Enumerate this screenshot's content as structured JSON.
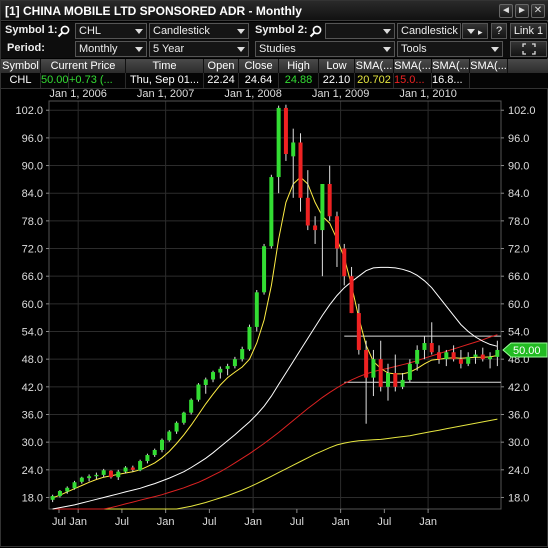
{
  "window": {
    "title": "[1] CHINA MOBILE LTD SPONSORED ADR - Monthly",
    "btn_left": "◄",
    "btn_right": "►",
    "btn_close": "✕"
  },
  "toolbar": {
    "symbol1_label": "Symbol 1:",
    "symbol1_value": "CHL",
    "style1_value": "Candlestick",
    "symbol2_label": "Symbol 2:",
    "symbol2_value": "",
    "style2_value": "Candlestick",
    "help_label": "?",
    "link_label": "Link 1",
    "period_label": "Period:",
    "period_value": "Monthly",
    "range_value": "5 Year",
    "studies_value": "Studies",
    "tools_value": "Tools"
  },
  "quote": {
    "headers": [
      "Symbol",
      "Current Price",
      "Time",
      "Open",
      "Close",
      "High",
      "Low",
      "SMA(...",
      "SMA(...",
      "SMA(...",
      "SMA(..."
    ],
    "values": [
      "CHL",
      "50.00",
      "+0.73 (...",
      "Thu, Sep 01...",
      "22.24",
      "24.64",
      "24.88",
      "22.10",
      "20.702",
      "15.0...",
      "16.8..."
    ],
    "up_color": "#33dd33",
    "down_color": "#ee2222"
  },
  "chart_data": {
    "type": "candlestick",
    "x_labels_top": [
      "Jan 1, 2006",
      "Jan 1, 2007",
      "Jan 1, 2008",
      "Jan 1, 2009",
      "Jan 1, 2010"
    ],
    "x_labels_bottom": [
      "Jul",
      "Jan",
      "Jul",
      "Jan",
      "Jul",
      "Jan",
      "Jul",
      "Jan",
      "Jul",
      "Jan"
    ],
    "y_ticks": [
      "102.0",
      "96.0",
      "90.0",
      "84.0",
      "78.0",
      "72.0",
      "66.0",
      "60.0",
      "54.0",
      "48.0",
      "42.0",
      "36.0",
      "30.0",
      "24.0",
      "18.0"
    ],
    "ylim": [
      15.5,
      104
    ],
    "current_price_label": "50.00",
    "candles": [
      [
        17.5,
        18.6,
        17.0,
        18.3
      ],
      [
        18.3,
        19.6,
        18.0,
        19.4
      ],
      [
        19.3,
        20.4,
        18.8,
        20.1
      ],
      [
        20.0,
        21.6,
        19.7,
        21.3
      ],
      [
        21.4,
        22.5,
        21.0,
        22.3
      ],
      [
        22.2,
        23.0,
        21.5,
        22.6
      ],
      [
        22.6,
        23.4,
        22.0,
        22.9
      ],
      [
        22.9,
        24.2,
        22.4,
        23.9
      ],
      [
        23.8,
        23.9,
        22.1,
        22.4
      ],
      [
        22.4,
        24.0,
        21.8,
        23.6
      ],
      [
        23.6,
        24.8,
        23.2,
        24.5
      ],
      [
        24.5,
        24.9,
        23.6,
        24.0
      ],
      [
        23.9,
        26.2,
        23.7,
        25.9
      ],
      [
        25.9,
        27.5,
        25.4,
        27.2
      ],
      [
        27.2,
        28.6,
        26.8,
        28.3
      ],
      [
        28.3,
        30.8,
        27.8,
        30.5
      ],
      [
        30.4,
        32.6,
        30.1,
        32.3
      ],
      [
        32.3,
        34.5,
        31.8,
        34.2
      ],
      [
        34.2,
        36.6,
        33.8,
        36.4
      ],
      [
        36.4,
        39.5,
        36.0,
        39.2
      ],
      [
        39.2,
        42.8,
        38.8,
        42.5
      ],
      [
        42.4,
        44.0,
        40.5,
        43.6
      ],
      [
        43.6,
        45.5,
        43.0,
        45.2
      ],
      [
        45.1,
        46.4,
        43.8,
        45.9
      ],
      [
        45.9,
        47.0,
        44.5,
        46.5
      ],
      [
        46.5,
        48.5,
        46.0,
        48.0
      ],
      [
        48.0,
        50.7,
        47.5,
        50.2
      ],
      [
        50.1,
        55.5,
        49.8,
        55.0
      ],
      [
        55.0,
        63.0,
        54.0,
        62.5
      ],
      [
        62.5,
        73.0,
        62.0,
        72.5
      ],
      [
        72.5,
        88.0,
        72.0,
        87.5
      ],
      [
        87.5,
        103.0,
        84.0,
        102.5
      ],
      [
        102.5,
        103.2,
        91.0,
        92.5
      ],
      [
        92.0,
        98.0,
        83.0,
        95.0
      ],
      [
        95.0,
        97.0,
        80.0,
        83.0
      ],
      [
        83.0,
        89.0,
        76.0,
        77.0
      ],
      [
        77.0,
        79.0,
        73.0,
        76.0
      ],
      [
        76.0,
        82.0,
        66.0,
        86.0
      ],
      [
        86.0,
        90.0,
        78.0,
        79.0
      ],
      [
        79.0,
        80.0,
        68.0,
        72.0
      ],
      [
        72.0,
        73.0,
        64.0,
        66.0
      ],
      [
        66.0,
        68.0,
        58.0,
        58.0
      ],
      [
        58.0,
        60.0,
        49.0,
        50.0
      ],
      [
        50.0,
        52.0,
        34.0,
        44.0
      ],
      [
        44.0,
        50.0,
        40.0,
        48.0
      ],
      [
        48.0,
        52.0,
        41.0,
        42.0
      ],
      [
        42.0,
        47.0,
        39.0,
        45.0
      ],
      [
        45.0,
        49.0,
        41.0,
        42.0
      ],
      [
        42.0,
        45.0,
        41.5,
        43.5
      ],
      [
        43.5,
        48.0,
        43.0,
        47.0
      ],
      [
        47.0,
        51.0,
        45.5,
        50.0
      ],
      [
        50.0,
        53.0,
        48.0,
        51.5
      ],
      [
        51.5,
        56.0,
        49.0,
        49.5
      ],
      [
        49.5,
        51.0,
        47.0,
        48.0
      ],
      [
        48.0,
        50.0,
        46.5,
        49.5
      ],
      [
        49.5,
        51.0,
        47.5,
        48.0
      ],
      [
        48.0,
        50.0,
        46.0,
        47.0
      ],
      [
        47.0,
        49.5,
        46.5,
        48.5
      ],
      [
        48.5,
        50.0,
        47.0,
        49.0
      ],
      [
        49.0,
        50.5,
        47.5,
        48.0
      ],
      [
        48.0,
        49.5,
        46.0,
        48.5
      ],
      [
        48.5,
        52.0,
        46.5,
        50.0
      ]
    ],
    "sma_short": [
      17.9,
      18.5,
      19.2,
      19.9,
      20.6,
      21.3,
      21.9,
      22.4,
      22.7,
      23.0,
      23.3,
      23.6,
      24.0,
      24.7,
      25.5,
      26.6,
      28.0,
      29.7,
      31.6,
      33.7,
      36.0,
      38.3,
      40.4,
      42.4,
      44.0,
      45.2,
      46.3,
      48.0,
      51.5,
      56.5,
      64.0,
      74.0,
      82.0,
      86.0,
      87.5,
      86.0,
      82.0,
      79.0,
      77.5,
      74.0,
      70.0,
      64.0,
      57.0,
      51.0,
      47.5,
      46.0,
      45.0,
      44.8,
      44.8,
      45.2,
      46.0,
      47.0,
      47.8,
      48.0,
      48.2,
      48.3,
      48.2,
      48.3,
      48.4,
      48.4,
      48.5,
      48.8
    ],
    "sma_mid": [
      15.5,
      15.8,
      16.1,
      16.4,
      16.8,
      17.2,
      17.6,
      18.0,
      18.4,
      18.8,
      19.2,
      19.6,
      20.0,
      20.5,
      21.0,
      21.6,
      22.2,
      22.9,
      23.6,
      24.5,
      25.5,
      26.5,
      27.7,
      29.0,
      30.3,
      31.6,
      33.0,
      34.4,
      36.0,
      37.8,
      40.0,
      42.5,
      45.0,
      47.5,
      50.0,
      52.5,
      55.0,
      57.5,
      59.8,
      61.8,
      63.5,
      64.8,
      66.0,
      67.2,
      67.8,
      67.9,
      67.9,
      67.8,
      67.5,
      67.0,
      66.2,
      65.0,
      63.5,
      61.5,
      59.5,
      57.5,
      55.5,
      54.0,
      52.8,
      51.9,
      51.2,
      50.8
    ],
    "sma_long": [
      13.0,
      13.3,
      13.6,
      13.9,
      14.2,
      14.6,
      15.0,
      15.4,
      15.8,
      16.2,
      16.6,
      17.0,
      17.4,
      17.8,
      18.2,
      18.6,
      19.1,
      19.6,
      20.1,
      20.7,
      21.3,
      22.0,
      22.8,
      23.6,
      24.5,
      25.5,
      26.5,
      27.5,
      28.6,
      29.7,
      30.9,
      32.1,
      33.4,
      34.7,
      36.0,
      37.3,
      38.5,
      39.7,
      40.8,
      41.8,
      42.7,
      43.5,
      44.2,
      44.8,
      45.3,
      45.7,
      46.0,
      46.4,
      46.8,
      47.2,
      47.7,
      48.2,
      48.7,
      49.2,
      49.7,
      50.2,
      50.7,
      51.2,
      51.7,
      52.2,
      52.8,
      53.3
    ],
    "sma_xlong": [
      12.0,
      12.2,
      12.4,
      12.6,
      12.8,
      13.0,
      13.2,
      13.4,
      13.6,
      13.8,
      14.0,
      14.2,
      14.4,
      14.6,
      14.8,
      15.0,
      15.2,
      15.5,
      15.8,
      16.1,
      16.5,
      16.9,
      17.4,
      17.9,
      18.4,
      19.0,
      19.6,
      20.3,
      21.0,
      21.8,
      22.6,
      23.4,
      24.2,
      25.0,
      25.8,
      26.6,
      27.4,
      28.1,
      28.8,
      29.4,
      29.8,
      30.1,
      30.3,
      30.4,
      30.5,
      30.6,
      30.8,
      31.0,
      31.2,
      31.4,
      31.7,
      32.0,
      32.3,
      32.6,
      32.9,
      33.2,
      33.5,
      33.8,
      34.1,
      34.4,
      34.7,
      35.0
    ],
    "hlines": [
      53.0,
      43.0
    ],
    "colors": {
      "up": "#33dd33",
      "down": "#ee2222",
      "sma_short": "#ffee44",
      "sma_mid": "#ffffff",
      "sma_long": "#dd2222",
      "sma_xlong": "#e6e640",
      "price_tag": "#22bb22"
    }
  }
}
